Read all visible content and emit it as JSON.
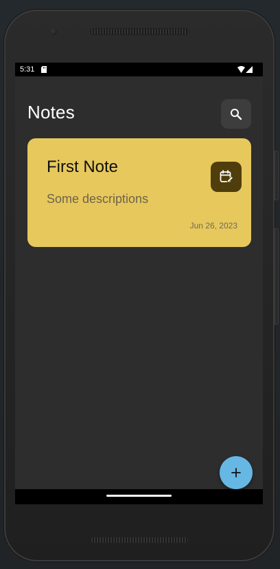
{
  "status_bar": {
    "time": "5:31",
    "icons": [
      "sd-card-icon",
      "wifi-icon",
      "signal-icon"
    ]
  },
  "header": {
    "title": "Notes",
    "search_icon": "search-icon"
  },
  "notes": [
    {
      "title": "First Note",
      "description": "Some descriptions",
      "date": "Jun 26, 2023",
      "edit_icon": "calendar-edit-icon"
    }
  ],
  "fab": {
    "icon": "plus-icon"
  },
  "colors": {
    "background": "#2d2d2d",
    "note_card": "#e7c85d",
    "edit_button": "#4f3d0b",
    "fab": "#66b7e3",
    "search_button": "#3d3d3d"
  }
}
